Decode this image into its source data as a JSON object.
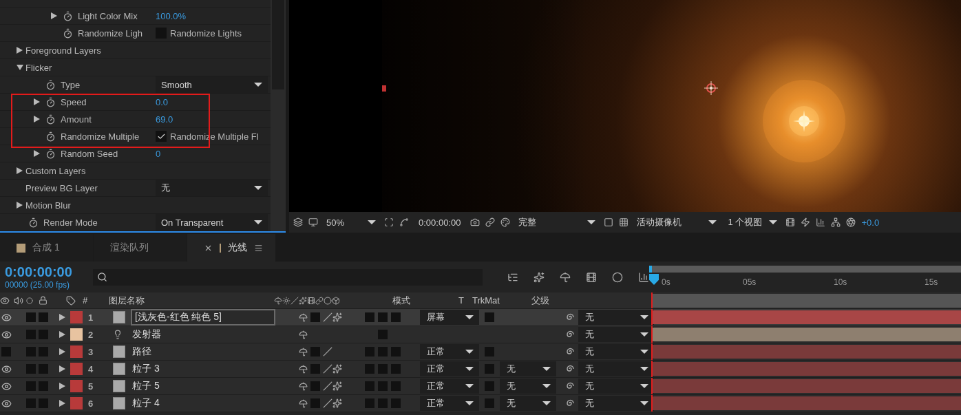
{
  "effect_controls": {
    "upper_rows": [
      {
        "label": "Light Color Mix",
        "stopwatch": true,
        "expanded": false,
        "value": {
          "kind": "number",
          "text": "100.0%"
        }
      },
      {
        "label": "Randomize Ligh",
        "stopwatch": true,
        "value": {
          "kind": "checkbox",
          "checked": false,
          "text": "Randomize Lights"
        }
      }
    ],
    "properties": [
      {
        "label": "Foreground Layers",
        "stopwatch": false,
        "expanded": false
      },
      {
        "label": "Flicker",
        "stopwatch": false,
        "expanded": true,
        "children": [
          {
            "label": "Type",
            "stopwatch": true,
            "value": {
              "kind": "dropdown",
              "text": "Smooth"
            }
          },
          {
            "label": "Speed",
            "stopwatch": true,
            "expanded": false,
            "highlighted": true,
            "value": {
              "kind": "number",
              "text": "0.0"
            }
          },
          {
            "label": "Amount",
            "stopwatch": true,
            "expanded": false,
            "highlighted": true,
            "value": {
              "kind": "number",
              "text": "69.0"
            }
          },
          {
            "label": "Randomize Multiple",
            "stopwatch": true,
            "highlighted": true,
            "value": {
              "kind": "checkbox",
              "checked": true,
              "text": "Randomize Multiple Fl"
            }
          },
          {
            "label": "Random Seed",
            "stopwatch": true,
            "expanded": false,
            "value": {
              "kind": "number",
              "text": "0"
            }
          }
        ]
      },
      {
        "label": "Custom Layers",
        "stopwatch": false,
        "expanded": false
      },
      {
        "label": "Preview BG Layer",
        "stopwatch": false,
        "value": {
          "kind": "dropdown",
          "text": "无"
        }
      },
      {
        "label": "Motion Blur",
        "stopwatch": false,
        "expanded": false
      },
      {
        "label": "Render Mode",
        "stopwatch": true,
        "value": {
          "kind": "dropdown",
          "text": "On Transparent"
        }
      }
    ]
  },
  "viewer_toolbar": {
    "zoom": "50%",
    "timecode": "0:00:00:00",
    "resolution": "完整",
    "camera": "活动摄像机",
    "views": "1 个视图",
    "exposure": "+0.0"
  },
  "tabs": [
    {
      "label": "合成 1",
      "kind": "composition",
      "selected": false
    },
    {
      "label": "渲染队列",
      "kind": "render_queue",
      "selected": false
    },
    {
      "label": "光线",
      "kind": "composition",
      "selected": true
    }
  ],
  "timeline": {
    "current_time": "0:00:00:00",
    "frame_info": "00000 (25.00 fps)",
    "ruler_ticks": [
      "0s",
      "05s",
      "10s",
      "15s"
    ],
    "columns": {
      "number": "#",
      "layer_name": "图层名称",
      "mode": "模式",
      "t": "T",
      "trkmat": "TrkMat",
      "parent": "父级"
    },
    "layers": [
      {
        "number": "1",
        "name": "[浅灰色-红色 纯色 5]",
        "kind": "solid",
        "color": "#b83a3a",
        "visible": true,
        "selected": true,
        "quality": true,
        "fx": true,
        "mode": "屏幕",
        "parent": "无"
      },
      {
        "number": "2",
        "name": "发射器",
        "kind": "light",
        "color": "#e8c3a0",
        "visible": true,
        "selected": false,
        "parent": "无"
      },
      {
        "number": "3",
        "name": "路径",
        "kind": "solid",
        "color": "#b83a3a",
        "visible": false,
        "selected": false,
        "quality": true,
        "fx": false,
        "mode": "正常",
        "parent": "无"
      },
      {
        "number": "4",
        "name": "粒子 3",
        "kind": "solid",
        "color": "#b83a3a",
        "visible": true,
        "selected": false,
        "quality": true,
        "fx": true,
        "mode": "正常",
        "trkmat": "无",
        "parent": "无"
      },
      {
        "number": "5",
        "name": "粒子 5",
        "kind": "solid",
        "color": "#b83a3a",
        "visible": true,
        "selected": false,
        "quality": true,
        "fx": true,
        "mode": "正常",
        "trkmat": "无",
        "parent": "无"
      },
      {
        "number": "6",
        "name": "粒子 4",
        "kind": "solid",
        "color": "#b83a3a",
        "visible": true,
        "selected": false,
        "quality": true,
        "fx": true,
        "mode": "正常",
        "trkmat": "无",
        "parent": "无"
      }
    ]
  }
}
